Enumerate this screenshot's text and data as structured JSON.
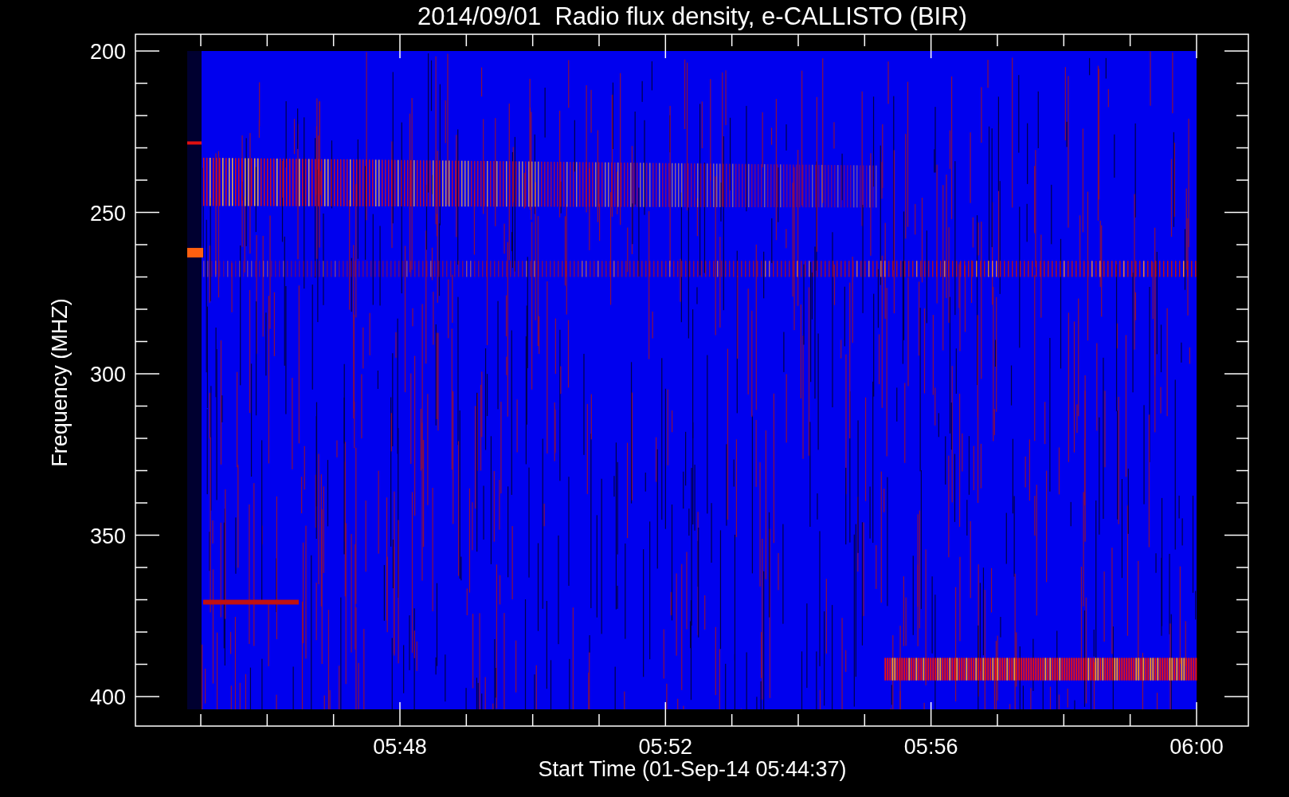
{
  "title": "2014/09/01  Radio flux density, e-CALLISTO (BIR)",
  "y_axis": {
    "label": "Frequency (MHZ)",
    "ticks": [
      "200",
      "250",
      "300",
      "350",
      "400"
    ]
  },
  "x_axis": {
    "label": "Start Time (01-Sep-14 05:44:37)",
    "ticks": [
      "05:48",
      "05:52",
      "05:56",
      "06:00"
    ]
  }
}
